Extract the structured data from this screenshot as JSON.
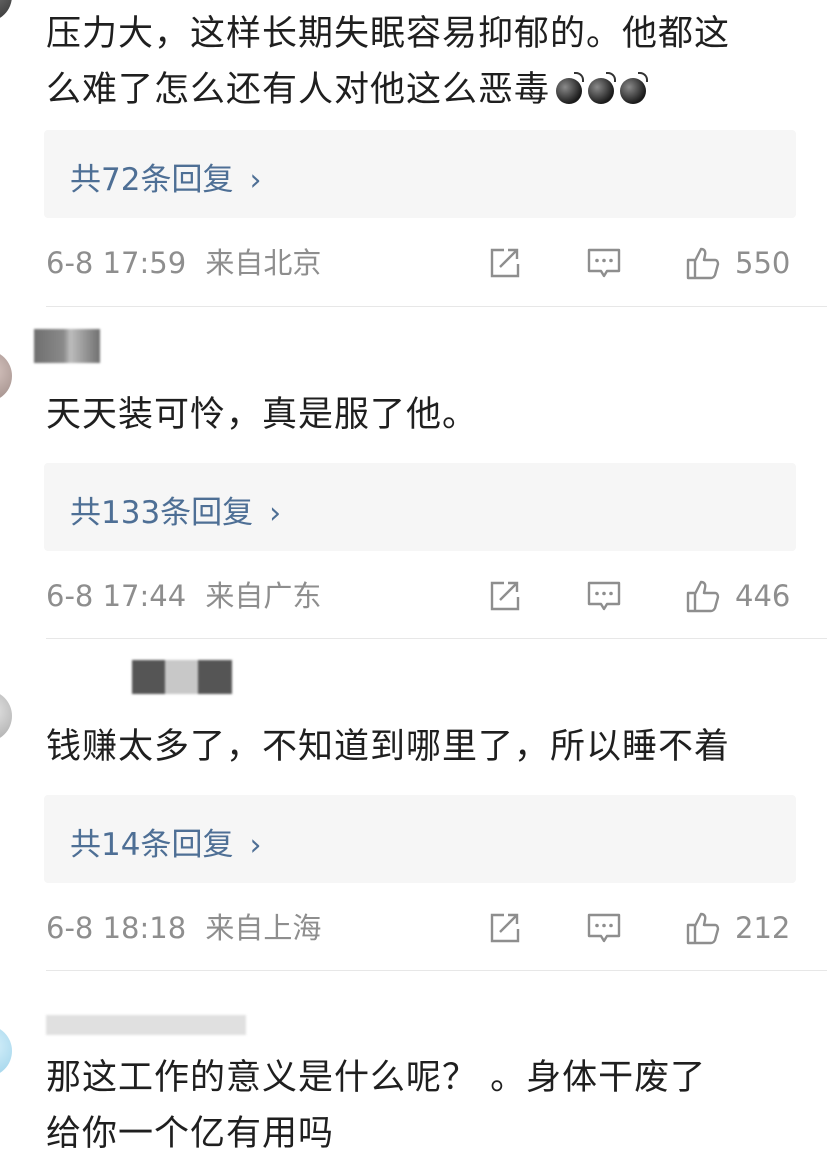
{
  "comments": [
    {
      "text_lines": [
        "压力大，这样长期失眠容易抑郁的。他都这",
        "么难了怎么还有人对他这么恶毒"
      ],
      "emoji_icon": "bomb-emoji",
      "reply_label": "共72条回复",
      "time": "6-8 17:59",
      "source": "来自北京",
      "likes": "550"
    },
    {
      "text_lines": [
        "天天装可怜，真是服了他。"
      ],
      "reply_label": "共133条回复",
      "time": "6-8 17:44",
      "source": "来自广东",
      "likes": "446"
    },
    {
      "text_lines": [
        "钱赚太多了，不知道到哪里了，所以睡不着"
      ],
      "reply_label": "共14条回复",
      "time": "6-8 18:18",
      "source": "来自上海",
      "likes": "212"
    },
    {
      "text_lines": [
        "那这工作的意义是什么呢？ 。身体干废了",
        "给你一个亿有用吗"
      ]
    }
  ],
  "icons": {
    "share": "share-icon",
    "comment": "comment-icon",
    "like": "thumbs-up-icon"
  },
  "colors": {
    "link": "#4e6f95",
    "meta": "#8e8e8e",
    "reply_bg": "#f6f6f6"
  }
}
